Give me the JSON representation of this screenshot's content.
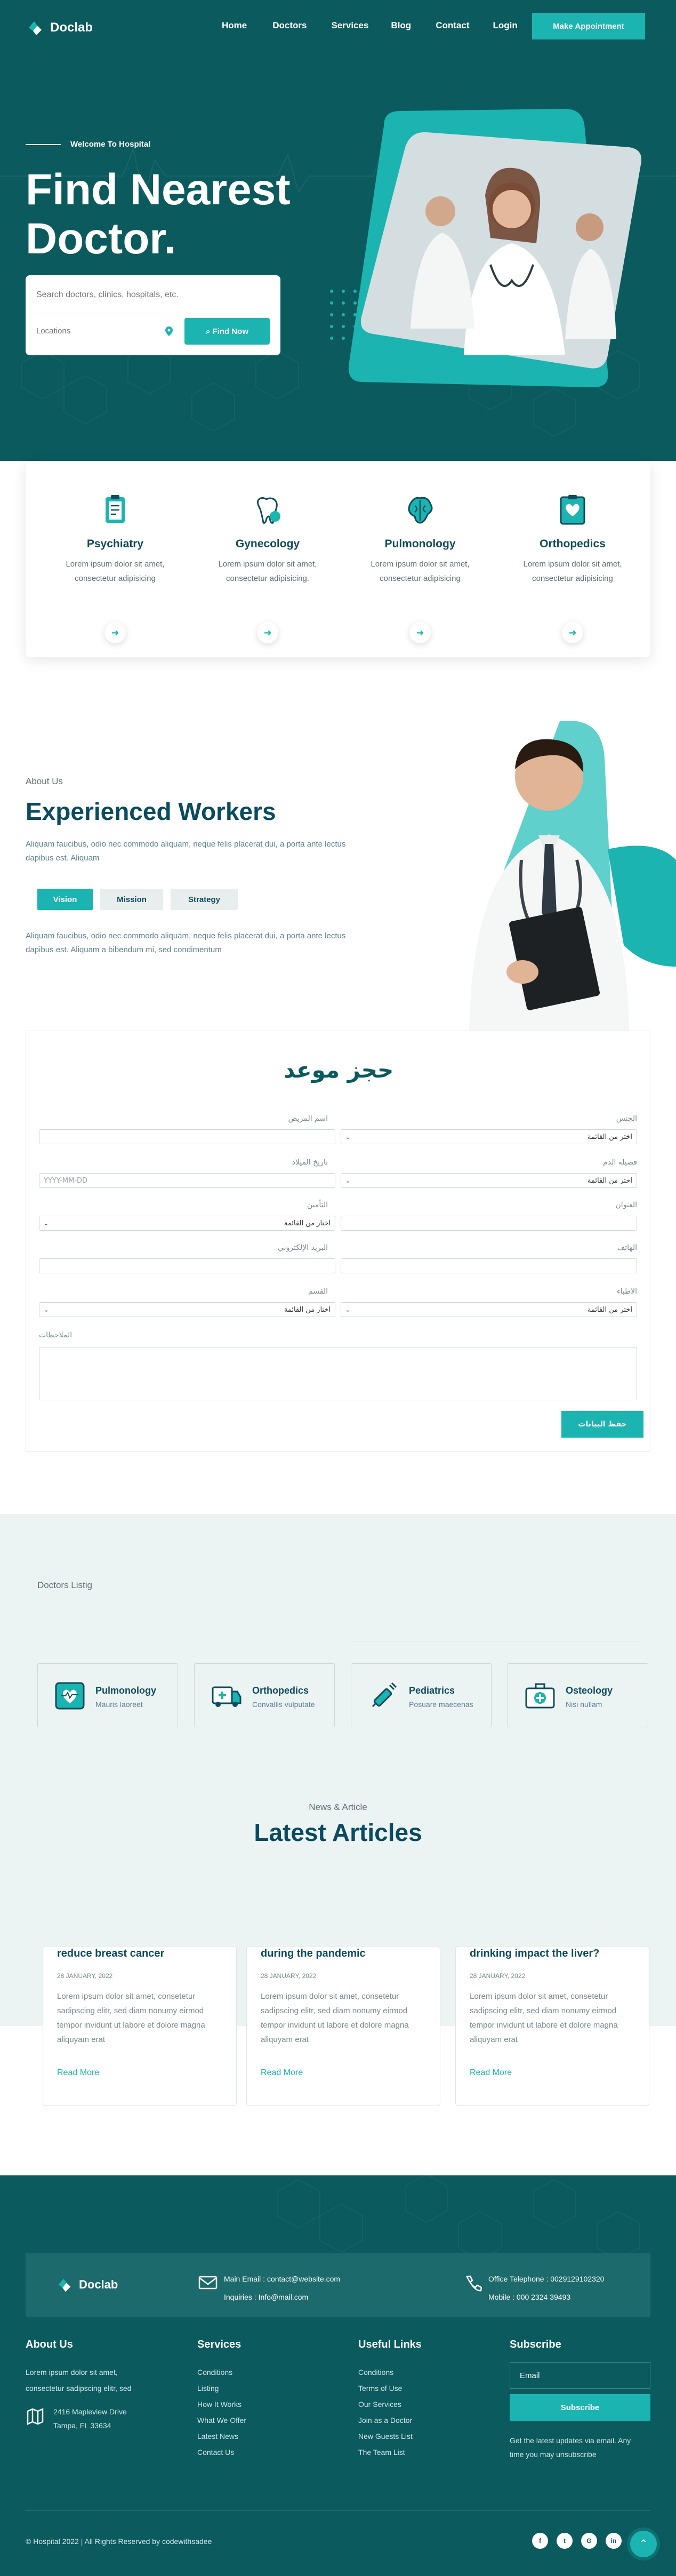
{
  "brand": {
    "name": "Doclab"
  },
  "nav": {
    "links": [
      "Home",
      "Doctors",
      "Services",
      "Blog",
      "Contact",
      "Login"
    ],
    "cta": "Make Appointment"
  },
  "hero": {
    "eyebrow": "Welcome To Hospital",
    "title_line1": "Find Nearest",
    "title_line2": "Doctor.",
    "search_placeholder": "Search doctors, clinics, hospitals, etc.",
    "location_placeholder": "Locations",
    "find_button": "Find Now"
  },
  "specialities": [
    {
      "title": "Psychiatry",
      "text": "Lorem ipsum dolor sit amet, consectetur adipisicing",
      "icon": "clipboard-icon"
    },
    {
      "title": "Gynecology",
      "text": "Lorem ipsum dolor sit amet, consectetur adipisicing.",
      "icon": "tooth-icon"
    },
    {
      "title": "Pulmonology",
      "text": "Lorem ipsum dolor sit amet, consectetur adipisicing",
      "icon": "brain-icon"
    },
    {
      "title": "Orthopedics",
      "text": "Lorem ipsum dolor sit amet, consectetur adipisicing",
      "icon": "heart-icon"
    }
  ],
  "about": {
    "label": "About Us",
    "title": "Experienced Workers",
    "paragraph": "Aliquam faucibus, odio nec commodo aliquam, neque felis placerat dui, a porta ante lectus dapibus est. Aliquam",
    "tabs": [
      "Vision",
      "Mission",
      "Strategy"
    ],
    "tab_text": "Aliquam faucibus, odio nec commodo aliquam, neque felis placerat dui, a porta ante lectus dapibus est. Aliquam a bibendum mi, sed condimentum"
  },
  "booking": {
    "title": "حجز موعد",
    "fields": {
      "gender_label": "الجنس",
      "gender_value": "اختر من القائمة",
      "patient_name_label": "اسم المريض",
      "blood_label": "فصيلة الدم",
      "blood_value": "اختر من القائمة",
      "birth_label": "تاريخ الميلاد",
      "birth_placeholder": "YYYY-MM-DD",
      "address_label": "العنوان",
      "insurance_label": "التأمين",
      "insurance_value": "اختار من القائمة",
      "phone_label": "الهاتف",
      "email_label": "البريد الإلكتروني",
      "doctors_label": "الاطباء",
      "doctors_value": "اختر من القائمة",
      "department_label": "القسم",
      "department_value": "اختار من القائمة",
      "notes_label": "الملاحظات"
    },
    "save_button": "حفظ البيانات"
  },
  "doctors_listing": {
    "title": "Doctors Listig",
    "items": [
      {
        "title": "Pulmonology",
        "subtitle": "Mauris laoreet",
        "icon": "heart-rate-icon"
      },
      {
        "title": "Orthopedics",
        "subtitle": "Convallis vulputate",
        "icon": "ambulance-icon"
      },
      {
        "title": "Pediatrics",
        "subtitle": "Posuare maecenas",
        "icon": "syringe-icon"
      },
      {
        "title": "Osteology",
        "subtitle": "Nisi nullam",
        "icon": "first-aid-kit-icon"
      }
    ]
  },
  "news": {
    "label": "News & Article",
    "title": "Latest Articles",
    "articles": [
      {
        "title": "reduce breast cancer",
        "date": "28 JANUARY, 2022",
        "text": "Lorem ipsum dolor sit amet, consetetur sadipscing elitr, sed diam nonumy eirmod tempor invidunt ut labore et dolore magna aliquyam erat",
        "link": "Read More"
      },
      {
        "title": "during the pandemic",
        "date": "28 JANUARY, 2022",
        "text": "Lorem ipsum dolor sit amet, consetetur sadipscing elitr, sed diam nonumy eirmod tempor invidunt ut labore et dolore magna aliquyam erat",
        "link": "Read More"
      },
      {
        "title": "drinking impact the liver?",
        "date": "28 JANUARY, 2022",
        "text": "Lorem ipsum dolor sit amet, consetetur sadipscing elitr, sed diam nonumy eirmod tempor invidunt ut labore et dolore magna aliquyam erat",
        "link": "Read More"
      }
    ]
  },
  "footer": {
    "main_email": "Main Email : contact@website.com",
    "inquiries": "Inquiries : Info@mail.com",
    "office_phone": "Office Telephone : 0029129102320",
    "mobile": "Mobile : 000 2324 39493",
    "about_title": "About Us",
    "about_text_1": "Lorem ipsum dolor sit amet,",
    "about_text_2": "consectetur sadipscing elitr, sed",
    "address_1": "2416 Mapleview Drive",
    "address_2": "Tampa, FL 33634",
    "services_title": "Services",
    "services": [
      "Conditions",
      "Listing",
      "How It Works",
      "What We Offer",
      "Latest News",
      "Contact Us"
    ],
    "links_title": "Useful Links",
    "links": [
      "Conditions",
      "Terms of Use",
      "Our Services",
      "Join as a Doctor",
      "New Guests List",
      "The Team List"
    ],
    "subscribe_title": "Subscribe",
    "email_placeholder": "Email",
    "subscribe_button": "Subscribe",
    "subscribe_note_1": "Get the latest updates via email. Any",
    "subscribe_note_2": "time you may unsubscribe",
    "copyright": "© Hospital 2022 | All Rights Reserved by codewithsadee",
    "social": [
      "f",
      "t",
      "G",
      "in"
    ]
  },
  "colors": {
    "primary": "#0b5a5e",
    "accent": "#1bb4b0",
    "heading": "#0b4b5f"
  }
}
